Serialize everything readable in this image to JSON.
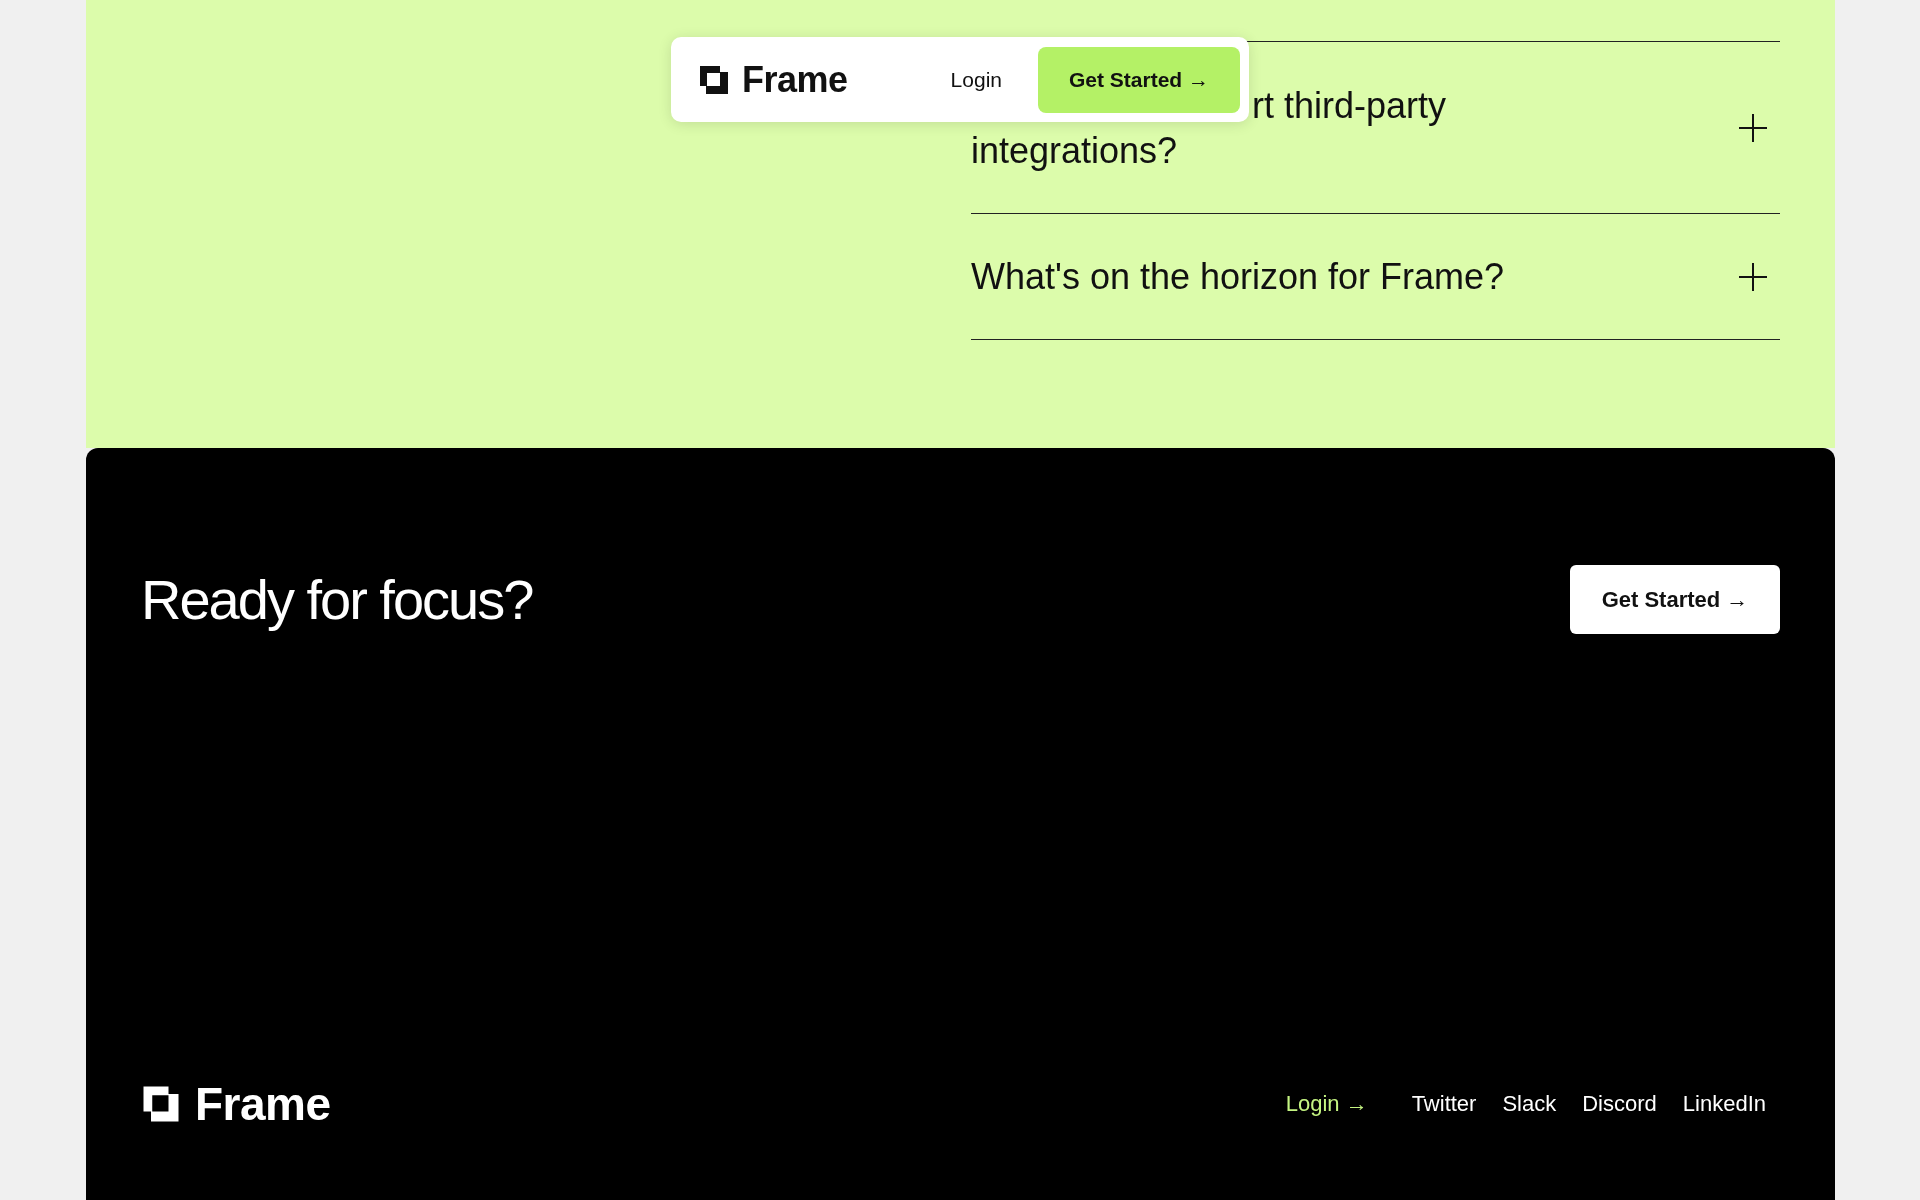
{
  "nav": {
    "brand": "Frame",
    "login": "Login",
    "cta": "Get Started →"
  },
  "faq": [
    {
      "kind": "covered",
      "lines": [
        "rt third-party",
        "integrations?"
      ],
      "expanded": false
    },
    {
      "kind": "plain",
      "lines": [
        "What's on the horizon for Frame?"
      ],
      "expanded": false
    }
  ],
  "cta_section": {
    "heading": "Ready for focus?",
    "button": "Get Started →"
  },
  "footer": {
    "brand": "Frame",
    "login": "Login →",
    "links": [
      "Twitter",
      "Slack",
      "Discord",
      "LinkedIn"
    ]
  }
}
